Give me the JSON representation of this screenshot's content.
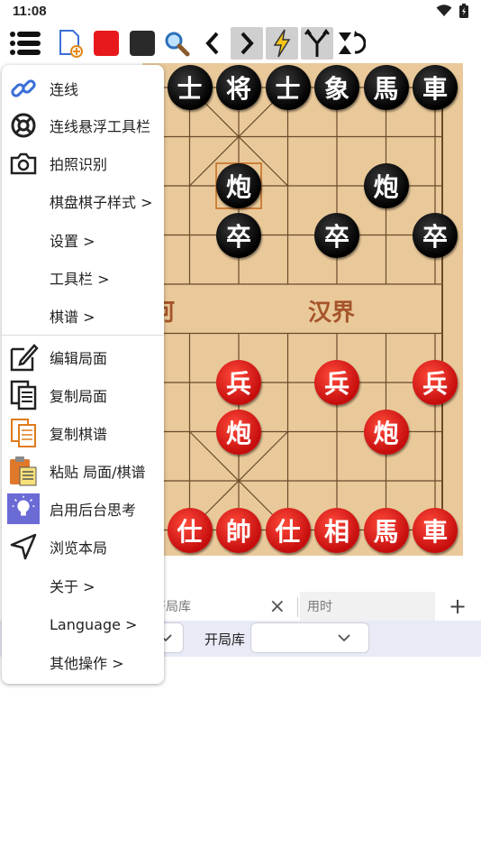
{
  "status": {
    "time": "11:08"
  },
  "colors": {
    "board": "#e9c99a",
    "line": "#6b4a2a",
    "red_piece": "#d0150f",
    "black_piece": "#111111",
    "filter_bar": "#e8eaf6",
    "highlight": "#c46a1c"
  },
  "toolbar": {
    "icons": [
      "menu-icon",
      "new-file-icon",
      "red-square-icon",
      "black-square-icon",
      "search-icon",
      "chevron-left-icon",
      "chevron-right-icon",
      "lightning-icon",
      "branch-icon",
      "flip-icon"
    ]
  },
  "board": {
    "river_left": "河",
    "river_right": "汉界",
    "pieces": [
      {
        "t": "士",
        "c": "black",
        "col": 1,
        "row": 0
      },
      {
        "t": "将",
        "c": "black",
        "col": 2,
        "row": 0
      },
      {
        "t": "士",
        "c": "black",
        "col": 3,
        "row": 0
      },
      {
        "t": "象",
        "c": "black",
        "col": 4,
        "row": 0
      },
      {
        "t": "馬",
        "c": "black",
        "col": 5,
        "row": 0
      },
      {
        "t": "車",
        "c": "black",
        "col": 6,
        "row": 0
      },
      {
        "t": "炮",
        "c": "black",
        "col": 2,
        "row": 2
      },
      {
        "t": "炮",
        "c": "black",
        "col": 5,
        "row": 2
      },
      {
        "t": "卒",
        "c": "black",
        "col": 2,
        "row": 3
      },
      {
        "t": "卒",
        "c": "black",
        "col": 4,
        "row": 3
      },
      {
        "t": "卒",
        "c": "black",
        "col": 6,
        "row": 3
      },
      {
        "t": "兵",
        "c": "red",
        "col": 2,
        "row": 6
      },
      {
        "t": "兵",
        "c": "red",
        "col": 4,
        "row": 6
      },
      {
        "t": "兵",
        "c": "red",
        "col": 6,
        "row": 6
      },
      {
        "t": "炮",
        "c": "red",
        "col": 2,
        "row": 7
      },
      {
        "t": "炮",
        "c": "red",
        "col": 5,
        "row": 7
      },
      {
        "t": "仕",
        "c": "red",
        "col": 1,
        "row": 9
      },
      {
        "t": "帥",
        "c": "red",
        "col": 2,
        "row": 9
      },
      {
        "t": "仕",
        "c": "red",
        "col": 3,
        "row": 9
      },
      {
        "t": "相",
        "c": "red",
        "col": 4,
        "row": 9
      },
      {
        "t": "馬",
        "c": "red",
        "col": 5,
        "row": 9
      },
      {
        "t": "車",
        "c": "red",
        "col": 6,
        "row": 9
      }
    ]
  },
  "tabs": {
    "opening_book": "开局库",
    "time_used": "用时",
    "close_symbol": "×",
    "add_symbol": "+"
  },
  "filter": {
    "label": "开局库"
  },
  "menu": {
    "items": [
      {
        "label": "连线",
        "icon": "link-icon"
      },
      {
        "label": "连线悬浮工具栏",
        "icon": "lifebuoy-icon"
      },
      {
        "label": "拍照识别",
        "icon": "camera-icon"
      },
      {
        "label": "棋盘棋子样式  >",
        "icon": ""
      },
      {
        "label": "设置  >",
        "icon": ""
      },
      {
        "label": "工具栏  >",
        "icon": ""
      },
      {
        "label": "棋谱  >",
        "icon": ""
      },
      {
        "label": "编辑局面",
        "icon": "edit-icon"
      },
      {
        "label": "复制局面",
        "icon": "copy-icon"
      },
      {
        "label": "复制棋谱",
        "icon": "copy-record-icon"
      },
      {
        "label": "粘贴 局面/棋谱",
        "icon": "paste-icon"
      },
      {
        "label": "启用后台思考",
        "icon": "lightbulb-icon"
      },
      {
        "label": "浏览本局",
        "icon": "navigate-icon"
      },
      {
        "label": "关于  >",
        "icon": ""
      },
      {
        "label": "Language  >",
        "icon": ""
      },
      {
        "label": "其他操作  >",
        "icon": ""
      }
    ]
  }
}
